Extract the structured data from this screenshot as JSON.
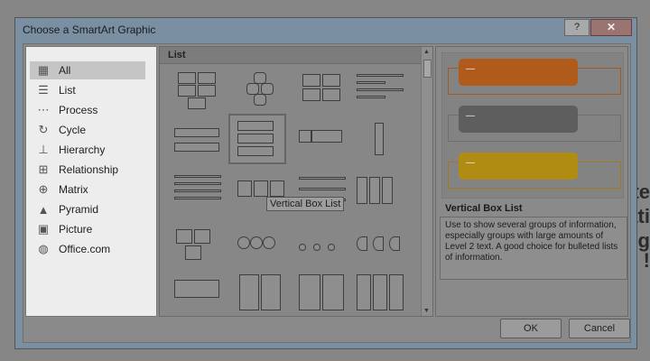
{
  "window": {
    "title": "Choose a SmartArt Graphic",
    "help_label": "?",
    "close_label": "✕"
  },
  "background_fragments": [
    "te",
    "ati",
    "g",
    "!"
  ],
  "sidebar": {
    "items": [
      {
        "label": "All",
        "icon": "all-icon",
        "glyph": "▦"
      },
      {
        "label": "List",
        "icon": "list-icon",
        "glyph": "☰"
      },
      {
        "label": "Process",
        "icon": "process-icon",
        "glyph": "⋯"
      },
      {
        "label": "Cycle",
        "icon": "cycle-icon",
        "glyph": "↻"
      },
      {
        "label": "Hierarchy",
        "icon": "hierarchy-icon",
        "glyph": "⊥"
      },
      {
        "label": "Relationship",
        "icon": "relationship-icon",
        "glyph": "⊞"
      },
      {
        "label": "Matrix",
        "icon": "matrix-icon",
        "glyph": "⊕"
      },
      {
        "label": "Pyramid",
        "icon": "pyramid-icon",
        "glyph": "▲"
      },
      {
        "label": "Picture",
        "icon": "picture-icon",
        "glyph": "▣"
      },
      {
        "label": "Office.com",
        "icon": "globe-icon",
        "glyph": "◍"
      }
    ],
    "selected": "All"
  },
  "gallery": {
    "heading": "List",
    "tooltip": "Vertical Box List"
  },
  "preview": {
    "title": "Vertical Box List",
    "description": "Use to show several groups of information, especially groups with large amounts of Level 2 text. A good choice for bulleted lists of information.",
    "placeholder": "—",
    "colors": {
      "orange": "#b05a1c",
      "gray": "#5e5e5e",
      "gold": "#b08c12",
      "orange_frame": "#a05a28",
      "gold_frame": "#a07a20"
    }
  },
  "buttons": {
    "ok": "OK",
    "cancel": "Cancel"
  }
}
